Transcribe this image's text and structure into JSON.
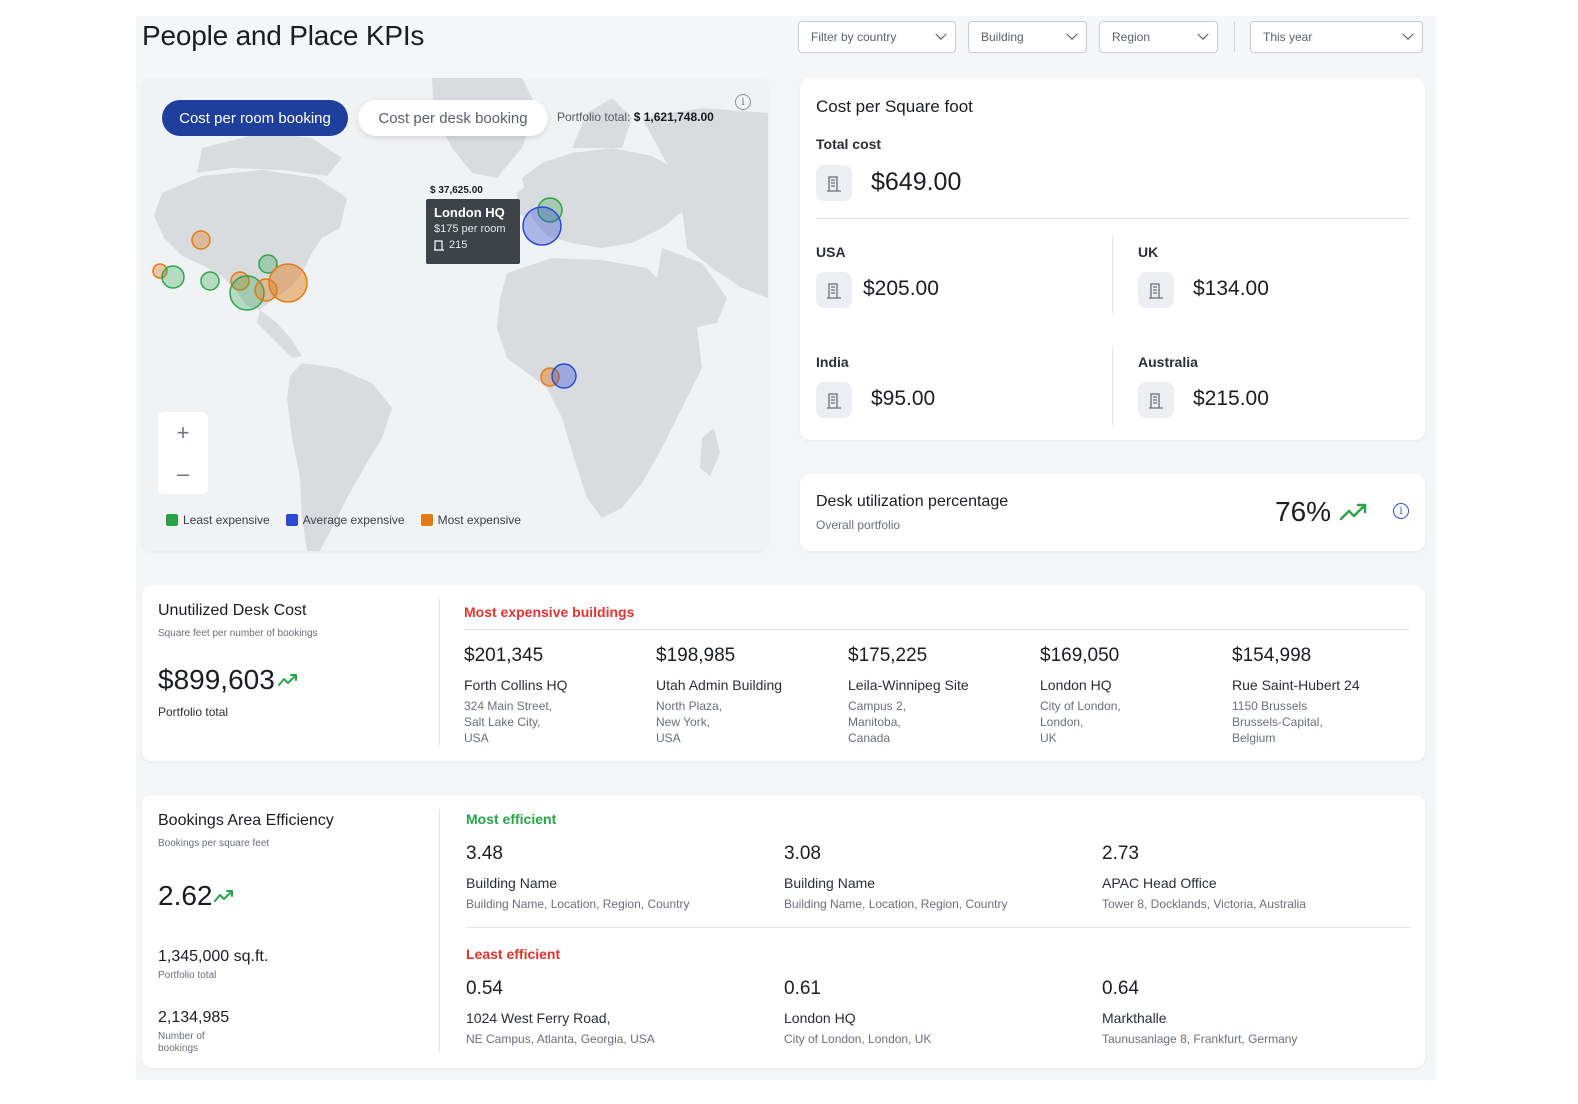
{
  "header": {
    "title": "People and Place KPIs",
    "filters": {
      "country": "Filter by country",
      "building": "Building",
      "region": "Region",
      "period": "This year"
    }
  },
  "map": {
    "tabs": {
      "active": "Cost per room booking",
      "inactive": "Cost per desk booking"
    },
    "portfolio_label": "Portfolio total:",
    "portfolio_value": "$ 1,621,748.00",
    "tooltip": {
      "amount": "$ 37,625.00",
      "name": "London HQ",
      "rate": "$175 per room",
      "rooms": "215"
    },
    "zoom": {
      "plus": "+",
      "minus": "–"
    },
    "legend": [
      {
        "label": "Least expensive",
        "color": "#2aa44a"
      },
      {
        "label": "Average expensive",
        "color": "#2a4bd1"
      },
      {
        "label": "Most expensive",
        "color": "#e07b16"
      }
    ]
  },
  "cost_per_sqft": {
    "title": "Cost per Square foot",
    "total_label": "Total cost",
    "total_value": "$649.00",
    "countries": [
      {
        "name": "USA",
        "value": "$205.00"
      },
      {
        "name": "UK",
        "value": "$134.00"
      },
      {
        "name": "India",
        "value": "$95.00"
      },
      {
        "name": "Australia",
        "value": "$215.00"
      }
    ]
  },
  "desk_util": {
    "title": "Desk utilization percentage",
    "subtitle": "Overall portfolio",
    "value": "76%"
  },
  "unutilized": {
    "title": "Unutilized Desk Cost",
    "subtitle": "Square feet per number of bookings",
    "value": "$899,603",
    "caption": "Portfolio total",
    "section_label": "Most expensive buildings",
    "buildings": [
      {
        "value": "$201,345",
        "name": "Forth Collins HQ",
        "addr1": "324 Main Street,",
        "addr2": "Salt Lake City,",
        "addr3": "USA"
      },
      {
        "value": "$198,985",
        "name": "Utah Admin Building",
        "addr1": "North Plaza,",
        "addr2": "New York,",
        "addr3": "USA"
      },
      {
        "value": "$175,225",
        "name": "Leila-Winnipeg Site",
        "addr1": "Campus 2,",
        "addr2": "Manitoba,",
        "addr3": "Canada"
      },
      {
        "value": "$169,050",
        "name": "London HQ",
        "addr1": "City of London,",
        "addr2": "London,",
        "addr3": "UK"
      },
      {
        "value": "$154,998",
        "name": "Rue Saint-Hubert 24",
        "addr1": "1150 Brussels",
        "addr2": "Brussels-Capital,",
        "addr3": "Belgium"
      }
    ]
  },
  "efficiency": {
    "title": "Bookings Area Efficiency",
    "subtitle": "Bookings per square feet",
    "value": "2.62",
    "area_value": "1,345,000 sq.ft.",
    "area_caption": "Portfolio total",
    "bookings_value": "2,134,985",
    "bookings_caption_1": "Number of",
    "bookings_caption_2": "bookings",
    "most_label": "Most efficient",
    "least_label": "Least efficient",
    "most": [
      {
        "value": "3.48",
        "name": "Building Name",
        "addr": "Building Name, Location, Region, Country"
      },
      {
        "value": "3.08",
        "name": "Building Name",
        "addr": "Building Name, Location, Region, Country"
      },
      {
        "value": "2.73",
        "name": "APAC Head Office",
        "addr": "Tower 8, Docklands, Victoria, Australia"
      }
    ],
    "least": [
      {
        "value": "0.54",
        "name": "1024 West Ferry Road,",
        "addr": "NE Campus, Atlanta, Georgia, USA"
      },
      {
        "value": "0.61",
        "name": "London HQ",
        "addr": "City of London, London, UK"
      },
      {
        "value": "0.64",
        "name": "Markthalle",
        "addr": "Taunusanlage 8, Frankfurt, Germany"
      }
    ]
  }
}
